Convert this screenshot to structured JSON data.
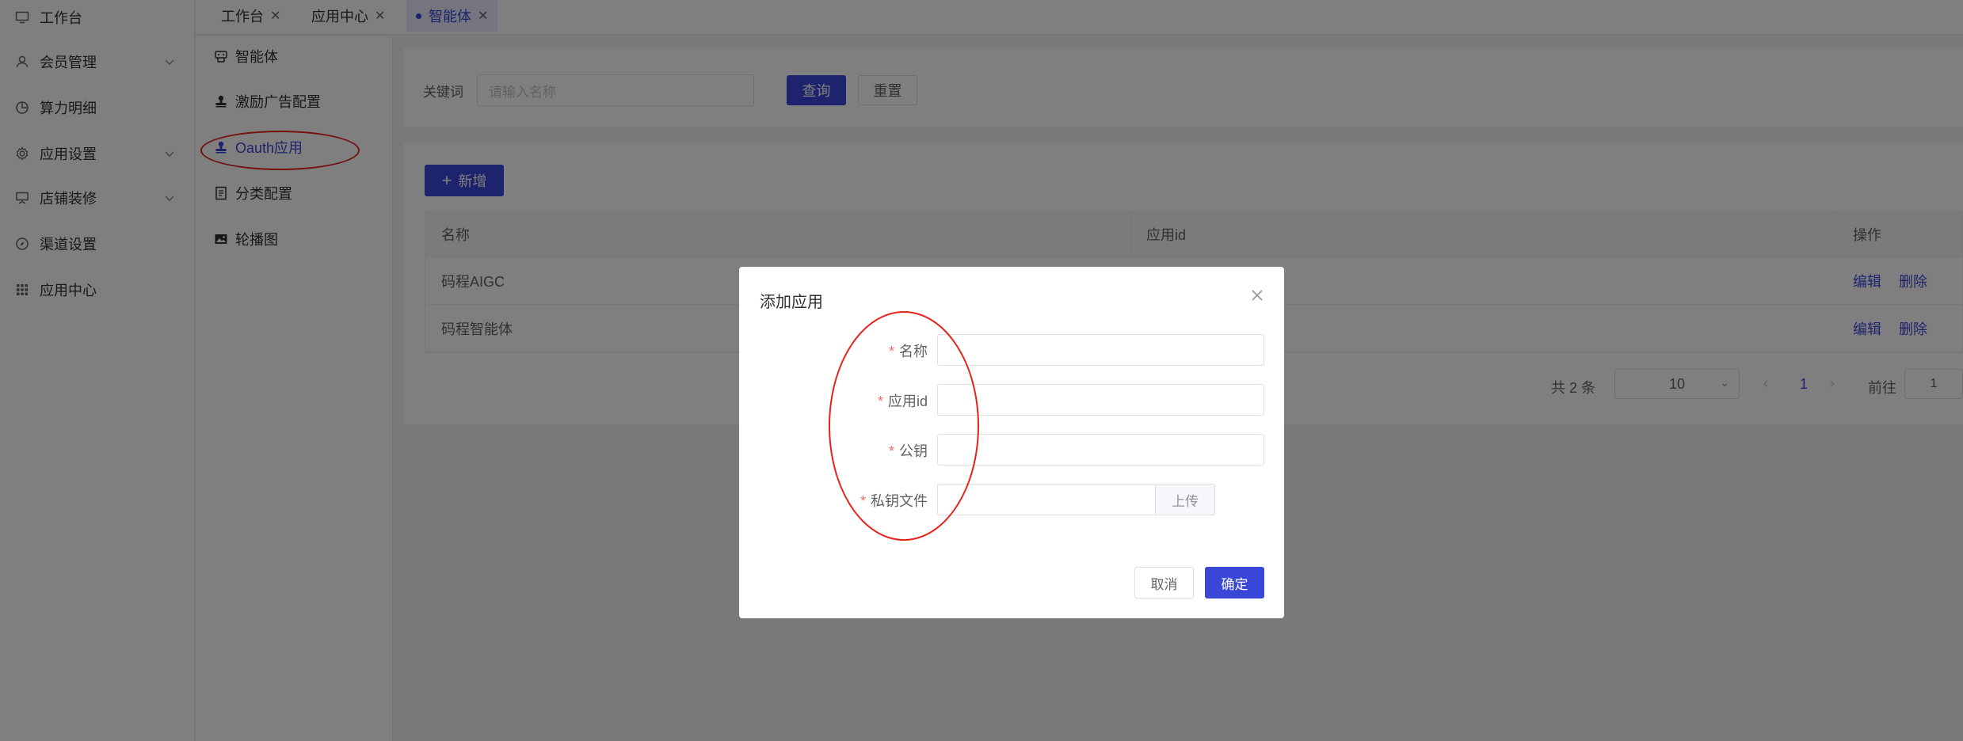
{
  "sidebar": {
    "items": [
      {
        "label": "工作台",
        "icon": "monitor-icon"
      },
      {
        "label": "会员管理",
        "icon": "user-icon",
        "expandable": true
      },
      {
        "label": "算力明细",
        "icon": "pie-chart-icon"
      },
      {
        "label": "应用设置",
        "icon": "gear-icon",
        "expandable": true
      },
      {
        "label": "店铺装修",
        "icon": "presentation-icon",
        "expandable": true
      },
      {
        "label": "渠道设置",
        "icon": "compass-icon"
      },
      {
        "label": "应用中心",
        "icon": "grid-icon"
      }
    ]
  },
  "tabs": [
    {
      "label": "工作台",
      "active": false
    },
    {
      "label": "应用中心",
      "active": false
    },
    {
      "label": "智能体",
      "active": true
    }
  ],
  "subnav": {
    "items": [
      {
        "label": "智能体",
        "icon": "robot-icon",
        "active": false
      },
      {
        "label": "激励广告配置",
        "icon": "stamp-icon",
        "active": false
      },
      {
        "label": "Oauth应用",
        "icon": "stamp-icon",
        "active": true
      },
      {
        "label": "分类配置",
        "icon": "document-icon",
        "active": false
      },
      {
        "label": "轮播图",
        "icon": "image-icon",
        "active": false
      }
    ]
  },
  "search": {
    "label": "关键词",
    "placeholder": "请输入名称",
    "query_button": "查询",
    "reset_button": "重置"
  },
  "toolbar": {
    "add_button": "新增",
    "add_icon": "plus-icon"
  },
  "table": {
    "columns": [
      "名称",
      "应用id",
      "操作"
    ],
    "rows": [
      {
        "name": "码程AIGC",
        "app_id": "",
        "edit": "编辑",
        "delete": "删除"
      },
      {
        "name": "码程智能体",
        "app_id": "",
        "edit": "编辑",
        "delete": "删除"
      }
    ]
  },
  "pagination": {
    "total_text": "共 2 条",
    "page_size": "10",
    "current_page": "1",
    "goto_label": "前往",
    "goto_value": "1"
  },
  "dialog": {
    "title": "添加应用",
    "fields": [
      {
        "label": "名称",
        "required": true,
        "value": ""
      },
      {
        "label": "应用id",
        "required": true,
        "value": ""
      },
      {
        "label": "公钥",
        "required": true,
        "value": ""
      },
      {
        "label": "私钥文件",
        "required": true,
        "value": "",
        "upload_label": "上传"
      }
    ],
    "cancel_button": "取消",
    "confirm_button": "确定"
  },
  "colors": {
    "primary": "#3a46d8",
    "required_asterisk": "#f56c6c",
    "annotation_circle": "#e8201a"
  }
}
